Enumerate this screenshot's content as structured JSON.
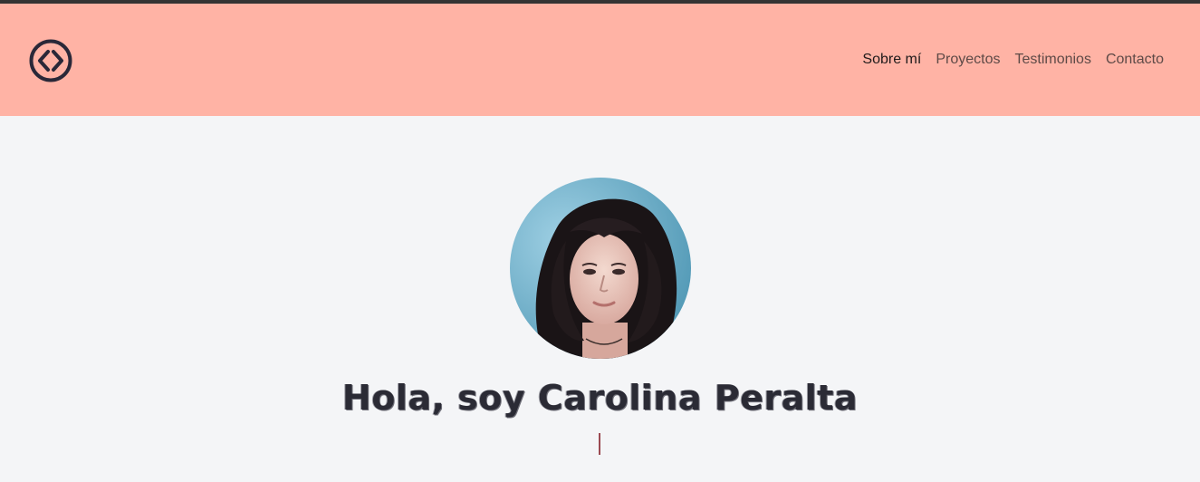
{
  "nav": {
    "items": [
      {
        "label": "Sobre mí",
        "active": true
      },
      {
        "label": "Proyectos",
        "active": false
      },
      {
        "label": "Testimonios",
        "active": false
      },
      {
        "label": "Contacto",
        "active": false
      }
    ]
  },
  "hero": {
    "title": "Hola, soy Carolina Peralta",
    "subtitle": ""
  },
  "colors": {
    "header_bg": "#ffb3a5",
    "page_bg": "#f4f5f7",
    "logo": "#2a2838",
    "title": "#2b2b35",
    "cursor": "#9b4a52"
  },
  "icons": {
    "logo": "code-brackets-circle-icon"
  }
}
